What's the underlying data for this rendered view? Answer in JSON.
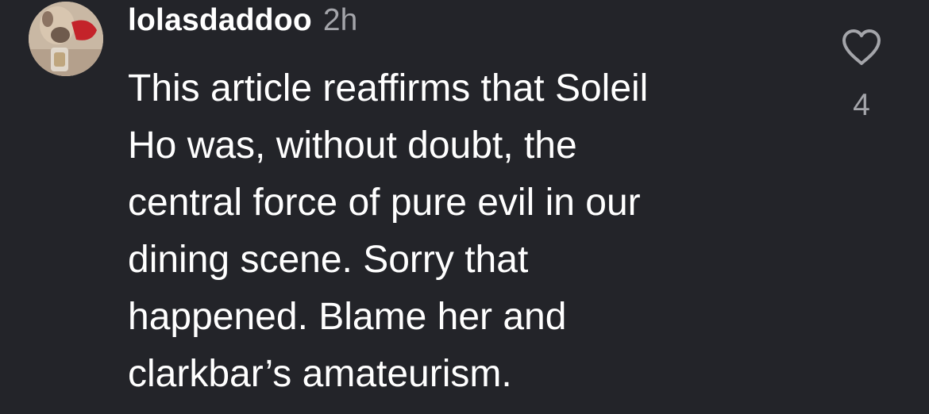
{
  "comment": {
    "username": "lolasdaddoo",
    "timestamp": "2h",
    "text": "This article reaffirms that Soleil\nHo was, without doubt, the\ncentral force of pure evil in our\ndining scene. Sorry that\nhappened. Blame her and\nclarkbar’s amateurism.",
    "avatar_icon": "avatar-photo-dog",
    "like_icon": "heart-outline-icon",
    "like_count": "4"
  },
  "colors": {
    "background": "#232429",
    "text_primary": "#ffffff",
    "text_secondary": "#a4a5aa"
  }
}
